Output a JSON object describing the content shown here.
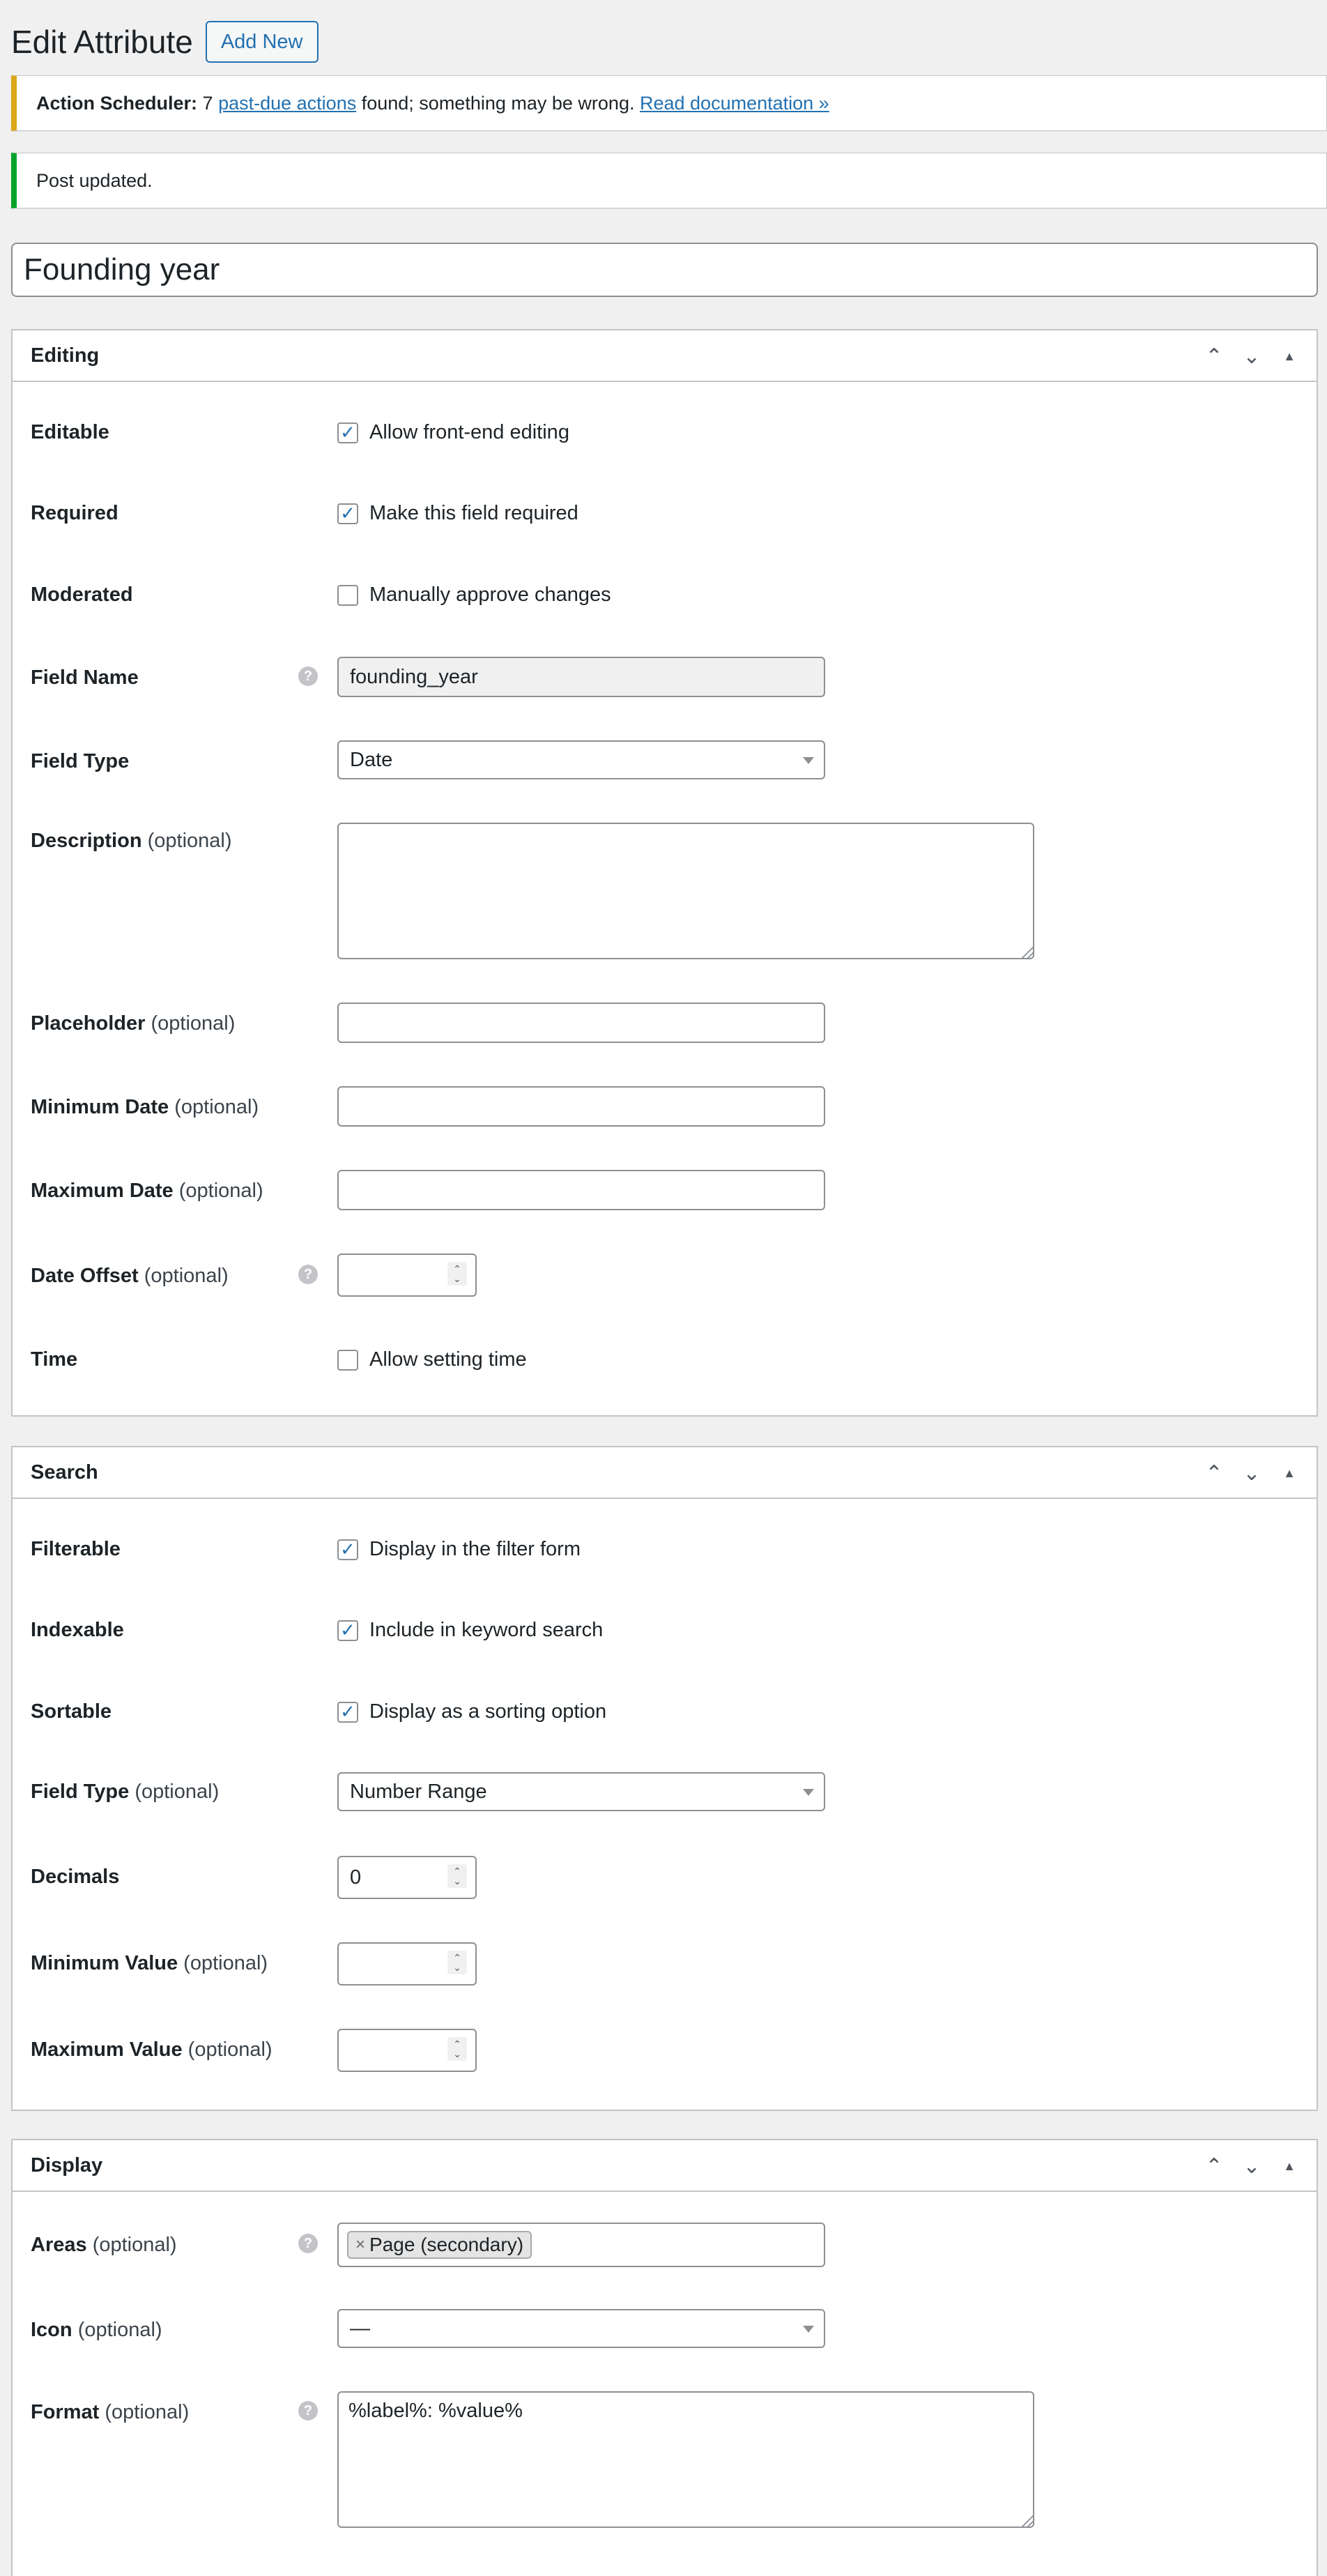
{
  "header": {
    "title": "Edit Attribute",
    "add_new_label": "Add New"
  },
  "notices": {
    "warning": {
      "prefix_bold": "Action Scheduler:",
      "count": "7",
      "link1": "past-due actions",
      "middle": "found; something may be wrong.",
      "link2": "Read documentation »"
    },
    "success": {
      "text": "Post updated."
    }
  },
  "post_title": "Founding year",
  "editing": {
    "title": "Editing",
    "editable": {
      "label": "Editable",
      "checkbox_label": "Allow front-end editing",
      "checked": true
    },
    "required": {
      "label": "Required",
      "checkbox_label": "Make this field required",
      "checked": true
    },
    "moderated": {
      "label": "Moderated",
      "checkbox_label": "Manually approve changes",
      "checked": false
    },
    "field_name": {
      "label": "Field Name",
      "value": "founding_year"
    },
    "field_type": {
      "label": "Field Type",
      "value": "Date"
    },
    "description": {
      "label": "Description",
      "optional": "(optional)",
      "value": ""
    },
    "placeholder": {
      "label": "Placeholder",
      "optional": "(optional)",
      "value": ""
    },
    "min_date": {
      "label": "Minimum Date",
      "optional": "(optional)",
      "value": ""
    },
    "max_date": {
      "label": "Maximum Date",
      "optional": "(optional)",
      "value": ""
    },
    "date_offset": {
      "label": "Date Offset",
      "optional": "(optional)",
      "value": ""
    },
    "time": {
      "label": "Time",
      "checkbox_label": "Allow setting time",
      "checked": false
    }
  },
  "search": {
    "title": "Search",
    "filterable": {
      "label": "Filterable",
      "checkbox_label": "Display in the filter form",
      "checked": true
    },
    "indexable": {
      "label": "Indexable",
      "checkbox_label": "Include in keyword search",
      "checked": true
    },
    "sortable": {
      "label": "Sortable",
      "checkbox_label": "Display as a sorting option",
      "checked": true
    },
    "field_type": {
      "label": "Field Type",
      "optional": "(optional)",
      "value": "Number Range"
    },
    "decimals": {
      "label": "Decimals",
      "value": "0"
    },
    "min_value": {
      "label": "Minimum Value",
      "optional": "(optional)",
      "value": ""
    },
    "max_value": {
      "label": "Maximum Value",
      "optional": "(optional)",
      "value": ""
    }
  },
  "display": {
    "title": "Display",
    "areas": {
      "label": "Areas",
      "optional": "(optional)",
      "tag": "Page (secondary)",
      "tag_remove": "×"
    },
    "icon": {
      "label": "Icon",
      "optional": "(optional)",
      "value": "—"
    },
    "format": {
      "label": "Format",
      "optional": "(optional)",
      "value": "%label%: %value%"
    }
  },
  "icons": {
    "help": "?",
    "check": "✓",
    "up": "⌃",
    "down": "⌄",
    "toggle": "▲",
    "spin_up": "⌃",
    "spin_down": "⌄"
  },
  "colors": {
    "accent": "#2271b1",
    "warning": "#dba617",
    "success": "#00a32a"
  }
}
